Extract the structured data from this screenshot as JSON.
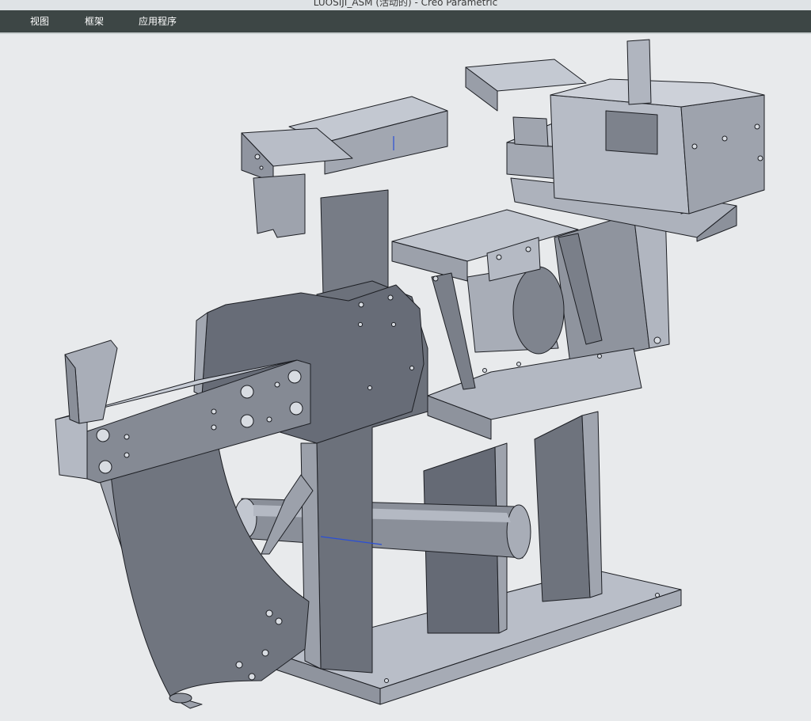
{
  "window": {
    "title": "LUOSIJI_ASM (活动的) - Creo Parametric"
  },
  "menu": {
    "items": [
      {
        "label": "视图"
      },
      {
        "label": "框架"
      },
      {
        "label": "应用程序"
      }
    ]
  },
  "colors": {
    "menubar_bg": "#3d4645",
    "viewport_bg": "#e8eaec",
    "model_face_light": "#b9bec8",
    "model_face_mid": "#979ca7",
    "model_face_dark": "#5f6470",
    "model_edge": "#1d1f24",
    "axis_line": "#2a4fd6"
  }
}
